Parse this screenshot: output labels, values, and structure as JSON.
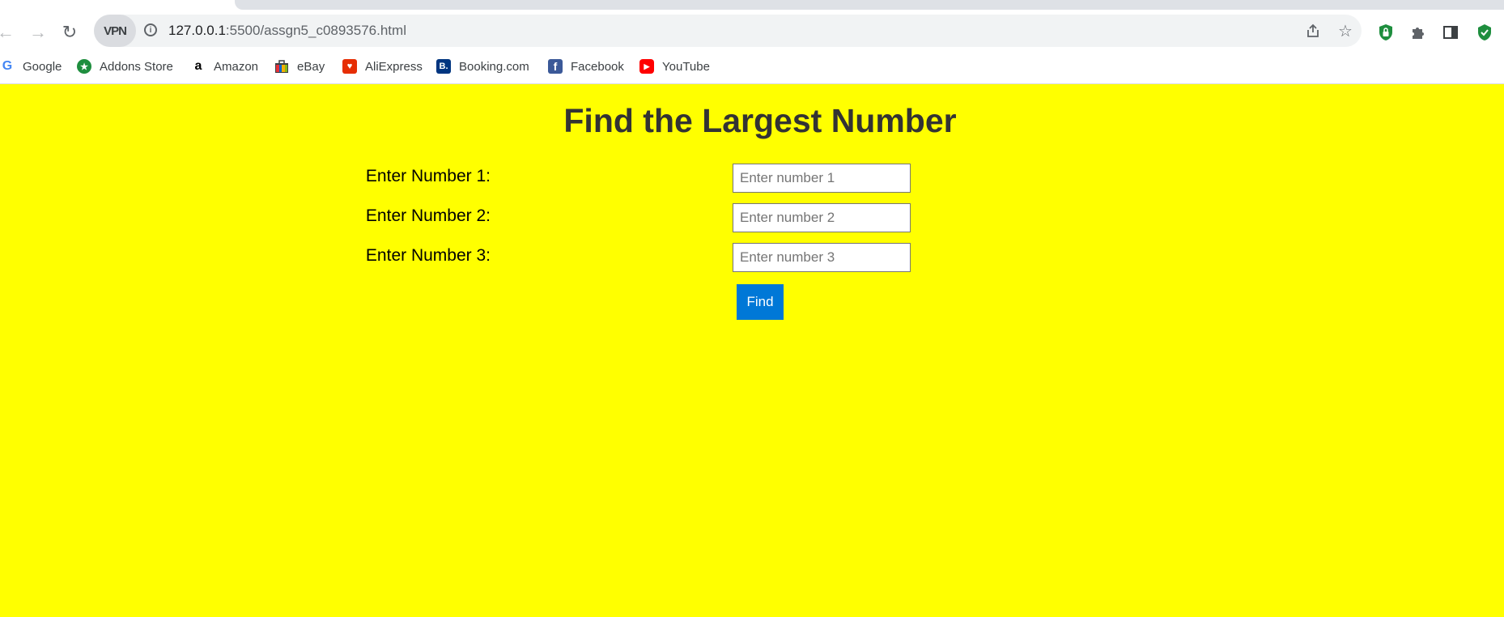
{
  "browser": {
    "vpn_label": "VPN",
    "url_host": "127.0.0.1",
    "url_path": ":5500/assgn5_c0893576.html",
    "bookmarks": [
      {
        "label": "Google",
        "icon": "google-icon"
      },
      {
        "label": "Addons Store",
        "icon": "addons-store-icon"
      },
      {
        "label": "Amazon",
        "icon": "amazon-icon"
      },
      {
        "label": "eBay",
        "icon": "ebay-icon"
      },
      {
        "label": "AliExpress",
        "icon": "aliexpress-icon"
      },
      {
        "label": "Booking.com",
        "icon": "booking-icon"
      },
      {
        "label": "Facebook",
        "icon": "facebook-icon"
      },
      {
        "label": "YouTube",
        "icon": "youtube-icon"
      }
    ]
  },
  "page": {
    "background": "#ffff00",
    "title": "Find the Largest Number",
    "fields": [
      {
        "label": "Enter Number 1:",
        "placeholder": "Enter number 1",
        "value": ""
      },
      {
        "label": "Enter Number 2:",
        "placeholder": "Enter number 2",
        "value": ""
      },
      {
        "label": "Enter Number 3:",
        "placeholder": "Enter number 3",
        "value": ""
      }
    ],
    "button_label": "Find",
    "button_color": "#0078d7"
  }
}
